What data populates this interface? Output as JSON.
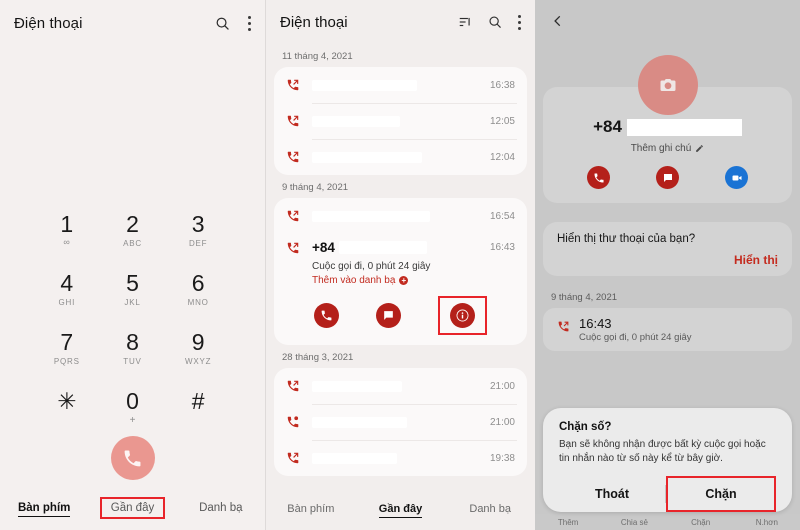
{
  "panel1": {
    "title": "Điện thoại",
    "icons": {
      "search": "search-icon",
      "more": "more-vertical-icon"
    },
    "dialpad": [
      {
        "num": "1",
        "sub": "∞"
      },
      {
        "num": "2",
        "sub": "ABC"
      },
      {
        "num": "3",
        "sub": "DEF"
      },
      {
        "num": "4",
        "sub": "GHI"
      },
      {
        "num": "5",
        "sub": "JKL"
      },
      {
        "num": "6",
        "sub": "MNO"
      },
      {
        "num": "7",
        "sub": "PQRS"
      },
      {
        "num": "8",
        "sub": "TUV"
      },
      {
        "num": "9",
        "sub": "WXYZ"
      },
      {
        "num": "✳",
        "sub": ""
      },
      {
        "num": "0",
        "sub": "+"
      },
      {
        "num": "#",
        "sub": ""
      }
    ],
    "call_button": "call-icon",
    "tabs": [
      {
        "label": "Bàn phím",
        "active": true,
        "highlighted": false
      },
      {
        "label": "Gần đây",
        "active": false,
        "highlighted": true
      },
      {
        "label": "Danh bạ",
        "active": false,
        "highlighted": false
      }
    ]
  },
  "panel2": {
    "title": "Điện thoại",
    "icons": {
      "sort": "sort-icon",
      "search": "search-icon",
      "more": "more-vertical-icon"
    },
    "groups": [
      {
        "date": "11 tháng 4, 2021",
        "rows": [
          {
            "type": "outgoing",
            "redact_width": 105,
            "time": "16:38"
          },
          {
            "type": "outgoing",
            "redact_width": 88,
            "time": "12:05"
          },
          {
            "type": "outgoing",
            "redact_width": 110,
            "time": "12:04"
          }
        ]
      },
      {
        "date": "9 tháng 4, 2021",
        "rows": [
          {
            "type": "outgoing",
            "redact_width": 118,
            "time": "16:54"
          }
        ],
        "expanded": {
          "type": "outgoing",
          "number": "+84",
          "redact_width": 88,
          "time": "16:43",
          "detail": "Cuộc gọi đi, 0 phút 24 giây",
          "add_contact": "Thêm vào danh bạ",
          "actions": [
            {
              "name": "call",
              "highlighted": false
            },
            {
              "name": "message",
              "highlighted": false
            },
            {
              "name": "info",
              "highlighted": true
            }
          ]
        }
      },
      {
        "date": "28 tháng 3, 2021",
        "rows": [
          {
            "type": "outgoing",
            "redact_width": 90,
            "time": "21:00"
          },
          {
            "type": "missed",
            "redact_width": 95,
            "time": "21:00"
          },
          {
            "type": "outgoing",
            "redact_width": 85,
            "time": "19:38"
          }
        ]
      }
    ],
    "tabs": [
      {
        "label": "Bàn phím",
        "active": false
      },
      {
        "label": "Gần đây",
        "active": true
      },
      {
        "label": "Danh bạ",
        "active": false
      }
    ]
  },
  "panel3": {
    "back": "back-arrow-icon",
    "avatar": "camera-icon",
    "number_prefix": "+84",
    "add_note": "Thêm ghi chú",
    "note_icon": "pencil-icon",
    "actions": [
      {
        "name": "call-icon",
        "color": "#b4201a"
      },
      {
        "name": "message-icon",
        "color": "#b4201a"
      },
      {
        "name": "video-call-icon",
        "color": "#1a73d4"
      }
    ],
    "voicemail": {
      "question": "Hiển thị thư thoại của bạn?",
      "action": "Hiển thị",
      "action_color": "#c42b1f"
    },
    "log": {
      "date": "9 tháng 4, 2021",
      "time": "16:43",
      "detail": "Cuộc gọi đi, 0 phút 24 giây"
    },
    "dialog": {
      "title": "Chặn số?",
      "body": "Bạn sẽ không nhận được bất kỳ cuộc gọi hoặc tin nhắn nào từ số này kể từ bây giờ.",
      "cancel": "Thoát",
      "confirm": "Chặn",
      "confirm_highlighted": true
    },
    "bottom_bar": [
      "Thêm",
      "Chia sẻ",
      "Chặn",
      "N.hơn"
    ]
  },
  "highlight_color": "#e8242a"
}
